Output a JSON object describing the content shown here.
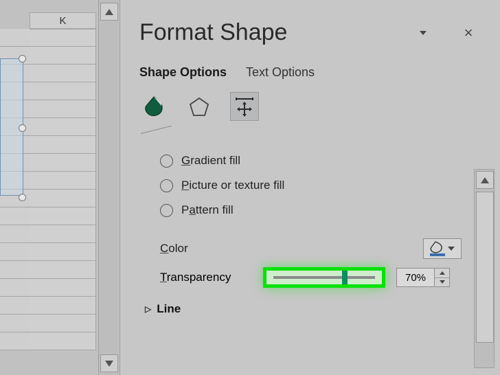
{
  "worksheet": {
    "column_letter": "K"
  },
  "pane": {
    "title": "Format Shape",
    "tabs": {
      "shape": "Shape Options",
      "text": "Text Options",
      "active": "shape"
    },
    "fill": {
      "options": {
        "gradient": "Gradient fill",
        "picture": "Picture or texture fill",
        "pattern": "Pattern fill"
      },
      "color_label": "Color",
      "transparency_label": "Transparency",
      "transparency_value": "70%",
      "transparency_percent": 70
    },
    "sections": {
      "line": "Line"
    }
  }
}
